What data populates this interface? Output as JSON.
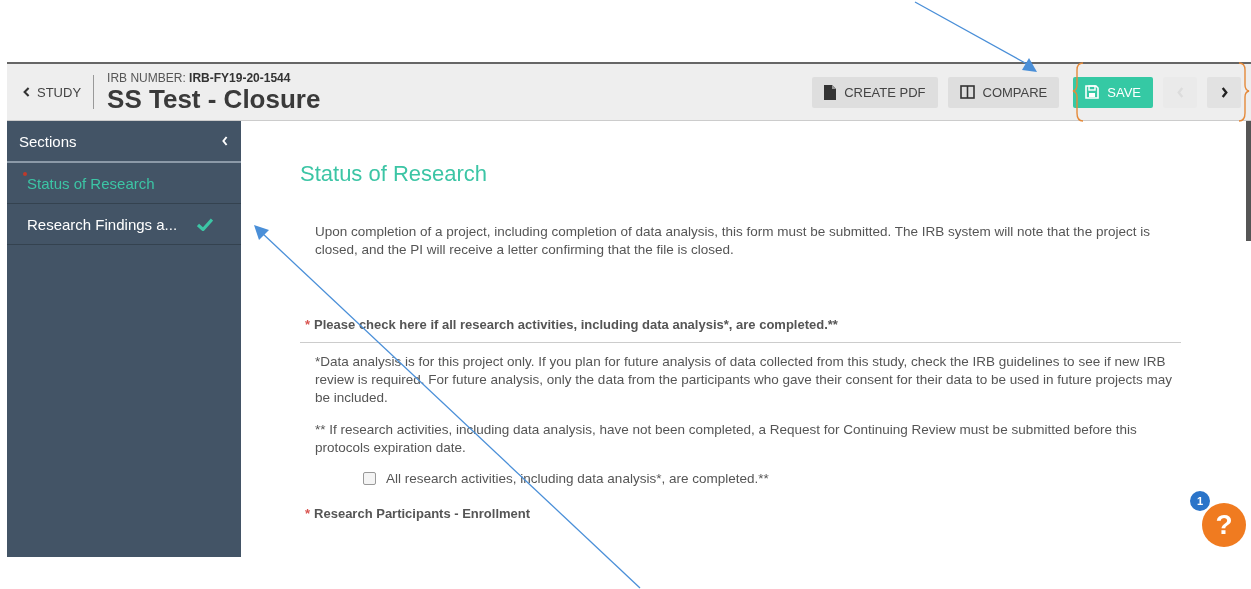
{
  "header": {
    "back_link": "STUDY",
    "irb_label": "IRB NUMBER:",
    "irb_number": "IRB-FY19-20-1544",
    "title": "SS Test - Closure",
    "buttons": [
      {
        "kind": "pdf",
        "label": "CREATE PDF",
        "disabled": false
      },
      {
        "kind": "compare",
        "label": "COMPARE",
        "disabled": false
      },
      {
        "kind": "save",
        "label": "SAVE",
        "disabled": false
      },
      {
        "kind": "prev",
        "disabled": true
      },
      {
        "kind": "next",
        "disabled": false
      }
    ]
  },
  "sidebar": {
    "title": "Sections",
    "items": [
      {
        "label": "Status of Research",
        "selected": true,
        "required": true,
        "complete": false
      },
      {
        "label": "Research Findings a...",
        "selected": false,
        "required": false,
        "complete": true
      }
    ]
  },
  "content": {
    "heading": "Status of Research",
    "intro": "Upon completion of a project, including completion of data analysis, this form must be submitted. The IRB system will note that the project is closed, and the PI will receive a letter confirming that the file is closed.",
    "question": {
      "label": "Please check here if all research activities, including data analysis*, are completed.**",
      "required_mark": "*"
    },
    "notes": [
      "*Data analysis is for this project only. If you plan for future analysis of data collected from this study, check the IRB guidelines to see if new IRB review is required. For future analysis, only the data from the participants who gave their consent for their data to be used in future projects may be included.",
      "** If research activities, including data analysis, have not been completed, a Request for Continuing Review must be submitted before this protocols expiration date."
    ],
    "checkbox": {
      "label": "All research activities, including data analysis*, are completed.**",
      "checked": false
    },
    "next_question": {
      "label": "Research Participants - Enrollment",
      "required_mark": "*"
    }
  },
  "help": {
    "badge": "1",
    "label": "?"
  }
}
